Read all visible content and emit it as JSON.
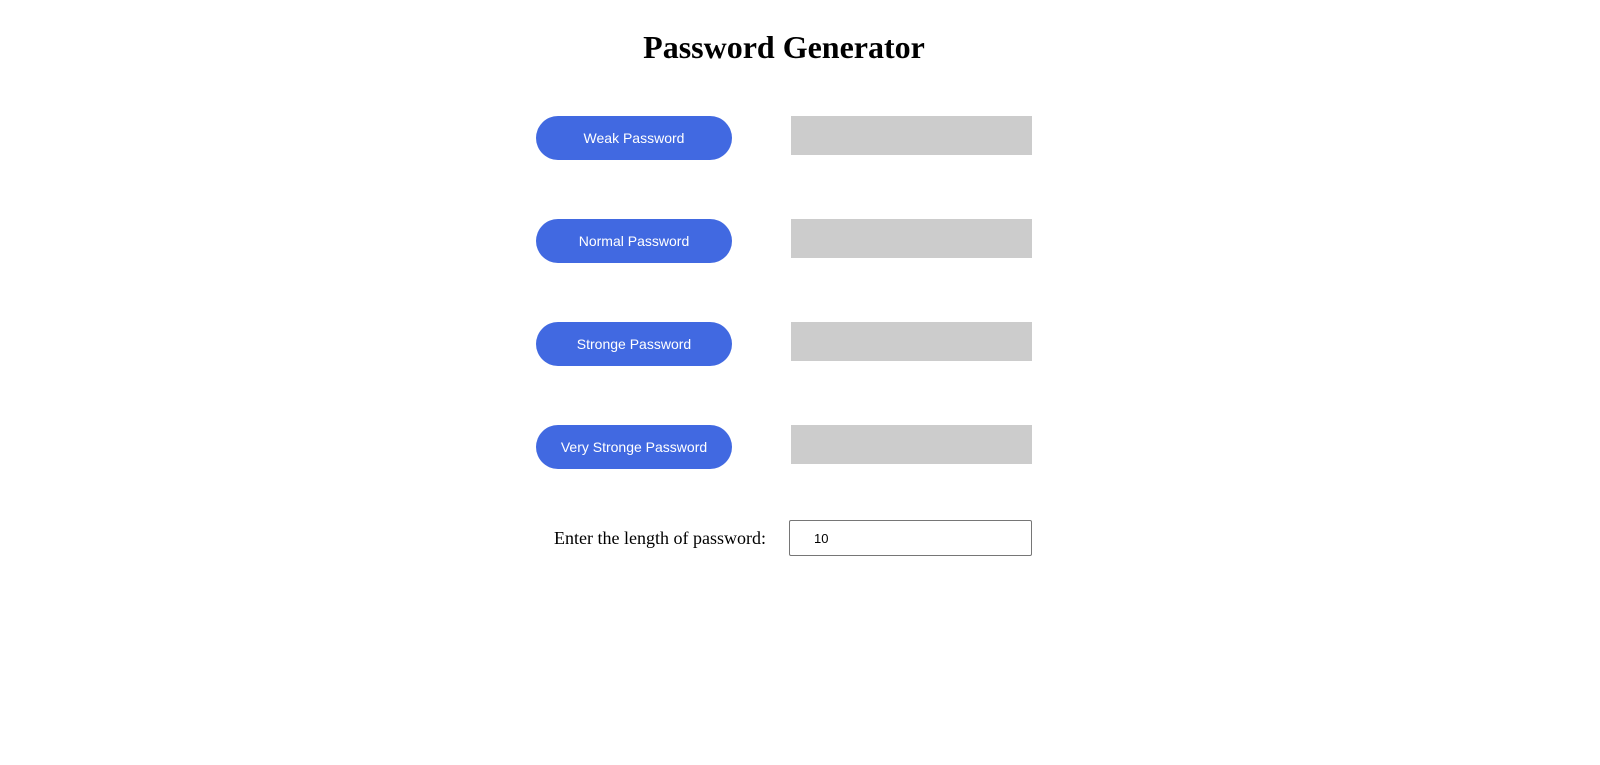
{
  "page": {
    "title": "Password Generator"
  },
  "generators": [
    {
      "button_label": "Weak Password",
      "output": ""
    },
    {
      "button_label": "Normal Password",
      "output": ""
    },
    {
      "button_label": "Stronge Password",
      "output": ""
    },
    {
      "button_label": "Very Stronge Password",
      "output": ""
    }
  ],
  "length": {
    "label": "Enter the length of password:",
    "value": "10"
  },
  "colors": {
    "button_background": "#4169e1",
    "button_text": "#ffffff",
    "output_background": "#cccccc"
  }
}
